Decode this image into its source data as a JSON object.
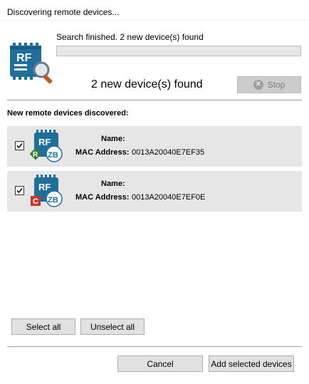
{
  "window": {
    "title": "Discovering remote devices..."
  },
  "search": {
    "status_text": "Search finished. 2 new device(s) found",
    "progress": 0,
    "found_summary": "2 new device(s) found",
    "stop_label": "Stop",
    "icon": "rf-module-magnifier-icon"
  },
  "devices_section": {
    "label": "New remote devices discovered:",
    "name_label": "Name:",
    "mac_label": "MAC Address:",
    "devices": [
      {
        "checked": true,
        "role_badge": "R",
        "role_color": "#3a7a3a",
        "protocol": "ZB",
        "name": "",
        "mac": "0013A20040E7EF35"
      },
      {
        "checked": true,
        "role_badge": "C",
        "role_color": "#c0392b",
        "protocol": "ZB",
        "name": "",
        "mac": "0013A20040E7EF0E"
      }
    ]
  },
  "actions": {
    "select_all": "Select all",
    "unselect_all": "Unselect all",
    "cancel": "Cancel",
    "add_selected": "Add selected devices"
  },
  "colors": {
    "device_blue": "#1f6f9a",
    "row_bg": "#e6e6e6"
  }
}
